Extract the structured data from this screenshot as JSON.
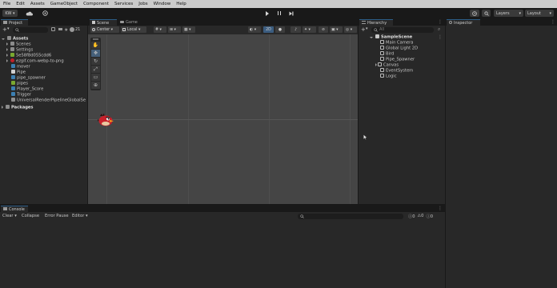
{
  "menu": [
    "File",
    "Edit",
    "Assets",
    "GameObject",
    "Component",
    "Services",
    "Jobs",
    "Window",
    "Help"
  ],
  "toolbar": {
    "account": "KW",
    "layers_label": "Layers",
    "layout_label": "Layout"
  },
  "project": {
    "tab_label": "Project",
    "add_label": "+",
    "badge_count": "21",
    "assets_label": "Assets",
    "items": [
      "Scenes",
      "Settings",
      "5e58f8d055cdd6",
      "ezgif.com-webp-to-png",
      "mover",
      "Pipe",
      "pipe_spawner",
      "pipes",
      "Player_Score",
      "Trigger",
      "UniversalRenderPipelineGlobalSe"
    ],
    "packages_label": "Packages"
  },
  "scene": {
    "tab_scene": "Scene",
    "tab_game": "Game",
    "center_label": "Center",
    "local_label": "Local",
    "mode_2d": "2D"
  },
  "hierarchy": {
    "tab_label": "Hierarchy",
    "search_placeholder": "All",
    "scene_name": "SampleScene",
    "items": [
      "Main Camera",
      "Global Light 2D",
      "Bird",
      "Pipe_Spawner",
      "Canvas",
      "EventSystem",
      "Logic"
    ]
  },
  "inspector": {
    "tab_label": "Inspector"
  },
  "console": {
    "tab_label": "Console",
    "clear": "Clear",
    "collapse": "Collapse",
    "error_pause": "Error Pause",
    "editor": "Editor",
    "warn_count": "0",
    "err_count": "0",
    "log_count": "0"
  },
  "colors": {
    "accent": "#2c5d87",
    "scene_bg": "#454545",
    "bird_red": "#c0202a"
  }
}
